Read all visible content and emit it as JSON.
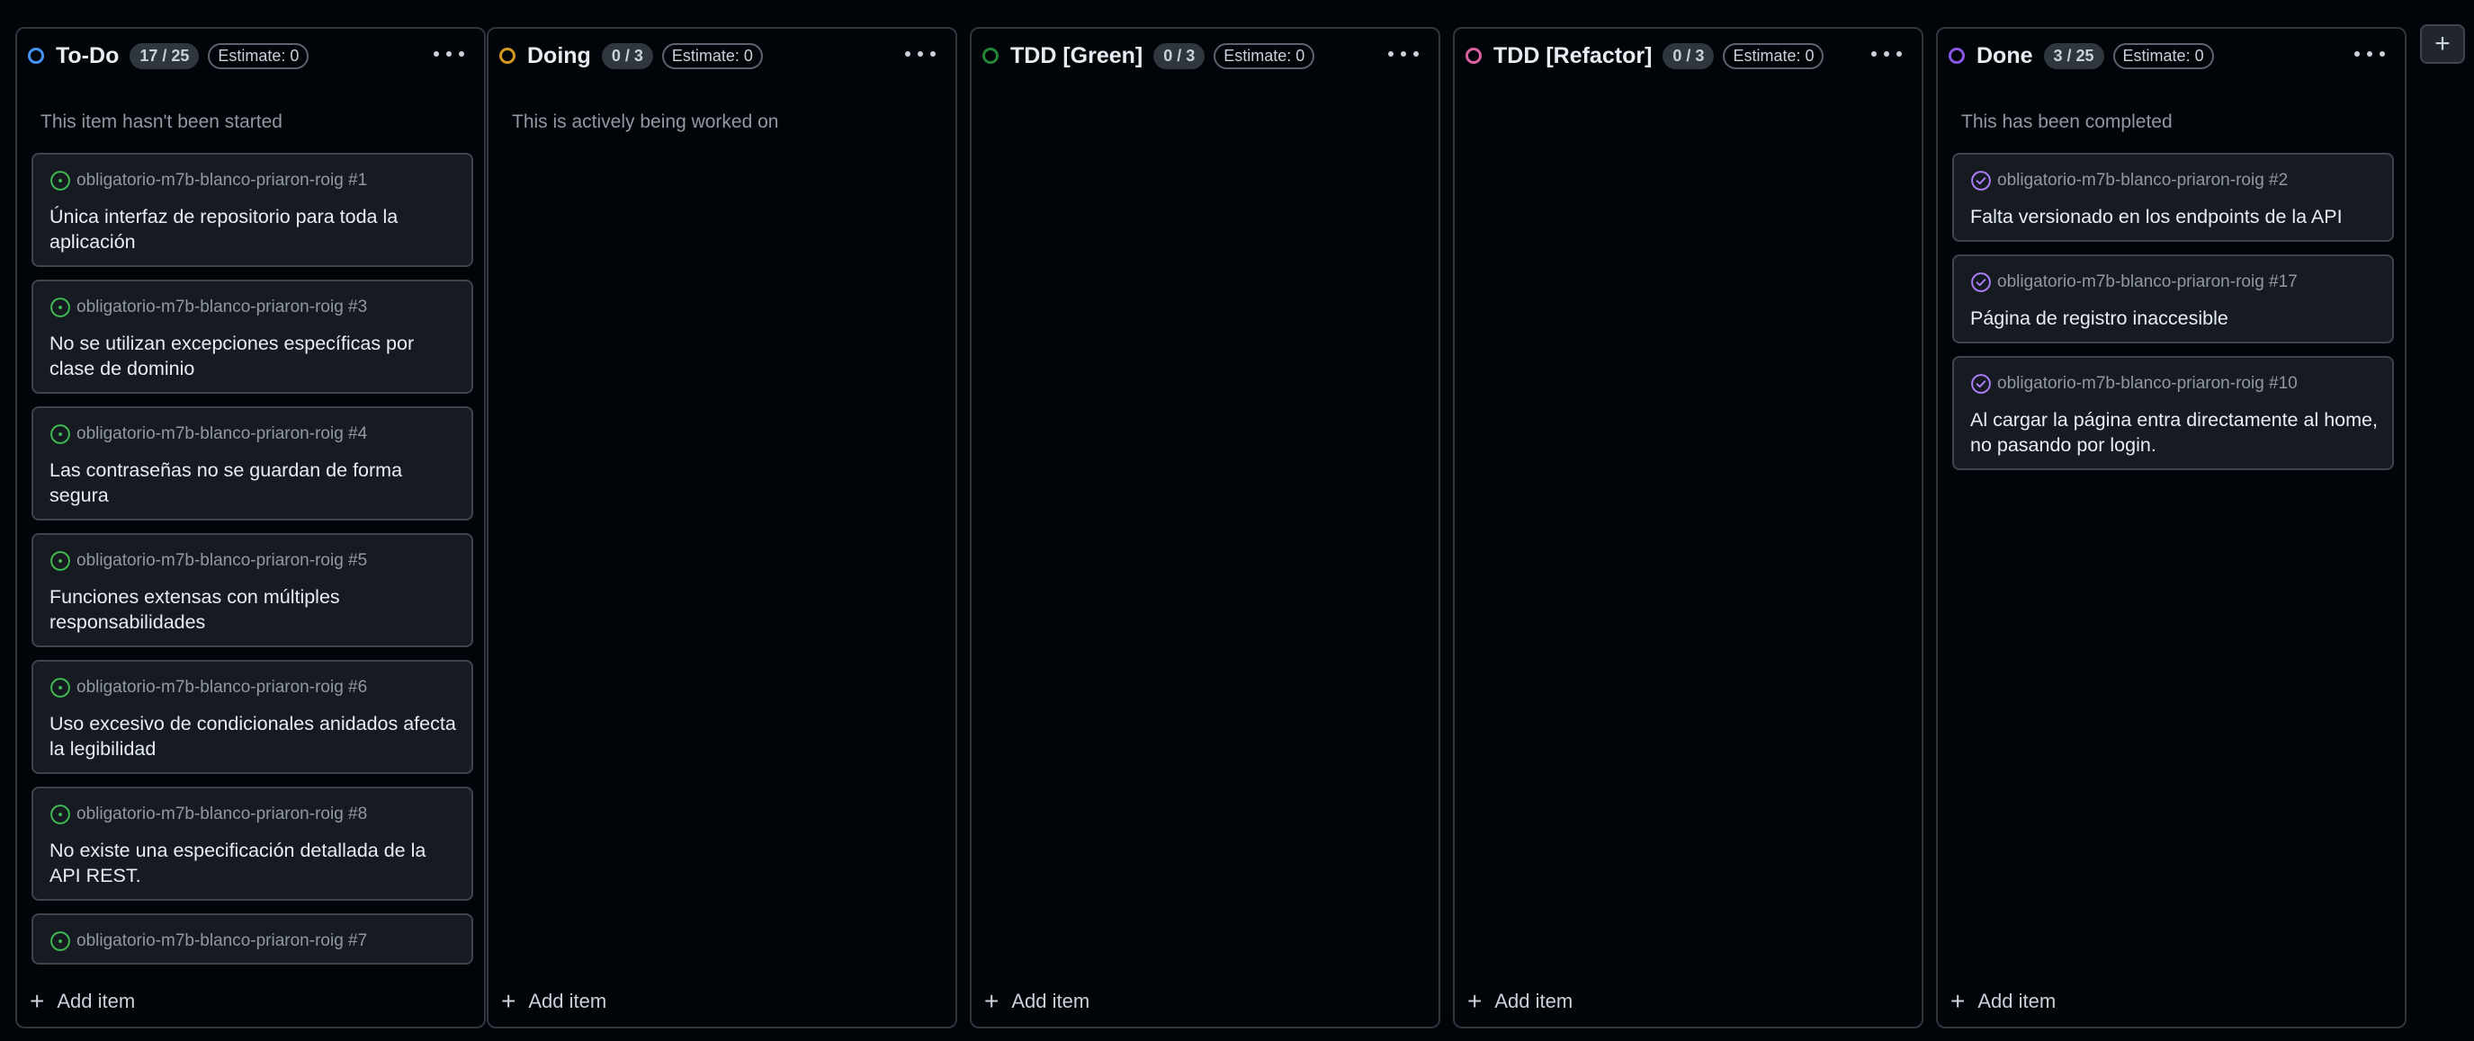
{
  "board": {
    "add_column_label": "+",
    "columns": [
      {
        "title": "To-Do",
        "count": "17 / 25",
        "estimate": "Estimate: 0",
        "description": "This item hasn't been started",
        "status_color": "#4493f8",
        "add_item_label": "Add item",
        "cards": [
          {
            "repo": "obligatorio-m7b-blanco-priaron-roig #1",
            "title": "Única interfaz de repositorio para toda la aplicación",
            "state": "open"
          },
          {
            "repo": "obligatorio-m7b-blanco-priaron-roig #3",
            "title": "No se utilizan excepciones específicas por clase de dominio",
            "state": "open"
          },
          {
            "repo": "obligatorio-m7b-blanco-priaron-roig #4",
            "title": "Las contraseñas no se guardan de forma segura",
            "state": "open"
          },
          {
            "repo": "obligatorio-m7b-blanco-priaron-roig #5",
            "title": "Funciones extensas con múltiples responsabilidades",
            "state": "open"
          },
          {
            "repo": "obligatorio-m7b-blanco-priaron-roig #6",
            "title": "Uso excesivo de condicionales anidados afecta la legibilidad",
            "state": "open"
          },
          {
            "repo": "obligatorio-m7b-blanco-priaron-roig #8",
            "title": "No existe una especificación detallada de la API REST.",
            "state": "open"
          },
          {
            "repo": "obligatorio-m7b-blanco-priaron-roig #7",
            "title": "",
            "state": "open"
          }
        ]
      },
      {
        "title": "Doing",
        "count": "0 / 3",
        "estimate": "Estimate: 0",
        "description": "This is actively being worked on",
        "status_color": "#d29922",
        "add_item_label": "Add item",
        "cards": []
      },
      {
        "title": "TDD [Green]",
        "count": "0 / 3",
        "estimate": "Estimate: 0",
        "description": "",
        "status_color": "#238636",
        "add_item_label": "Add item",
        "cards": []
      },
      {
        "title": "TDD [Refactor]",
        "count": "0 / 3",
        "estimate": "Estimate: 0",
        "description": "",
        "status_color": "#db61a2",
        "add_item_label": "Add item",
        "cards": []
      },
      {
        "title": "Done",
        "count": "3 / 25",
        "estimate": "Estimate: 0",
        "description": "This has been completed",
        "status_color": "#8957e5",
        "add_item_label": "Add item",
        "cards": [
          {
            "repo": "obligatorio-m7b-blanco-priaron-roig #2",
            "title": "Falta versionado en los endpoints de la API",
            "state": "closed"
          },
          {
            "repo": "obligatorio-m7b-blanco-priaron-roig #17",
            "title": "Página de registro inaccesible",
            "state": "closed"
          },
          {
            "repo": "obligatorio-m7b-blanco-priaron-roig #10",
            "title": "Al cargar la página entra directamente al home, no pasando por login.",
            "state": "closed"
          }
        ]
      }
    ]
  },
  "icons": {
    "open_issue": "issue-opened-icon",
    "closed_issue": "issue-closed-icon",
    "menu": "kebab-menu-icon",
    "add": "plus-icon"
  },
  "colors": {
    "open_issue": "#3fb950",
    "closed_issue": "#ab7df8"
  }
}
